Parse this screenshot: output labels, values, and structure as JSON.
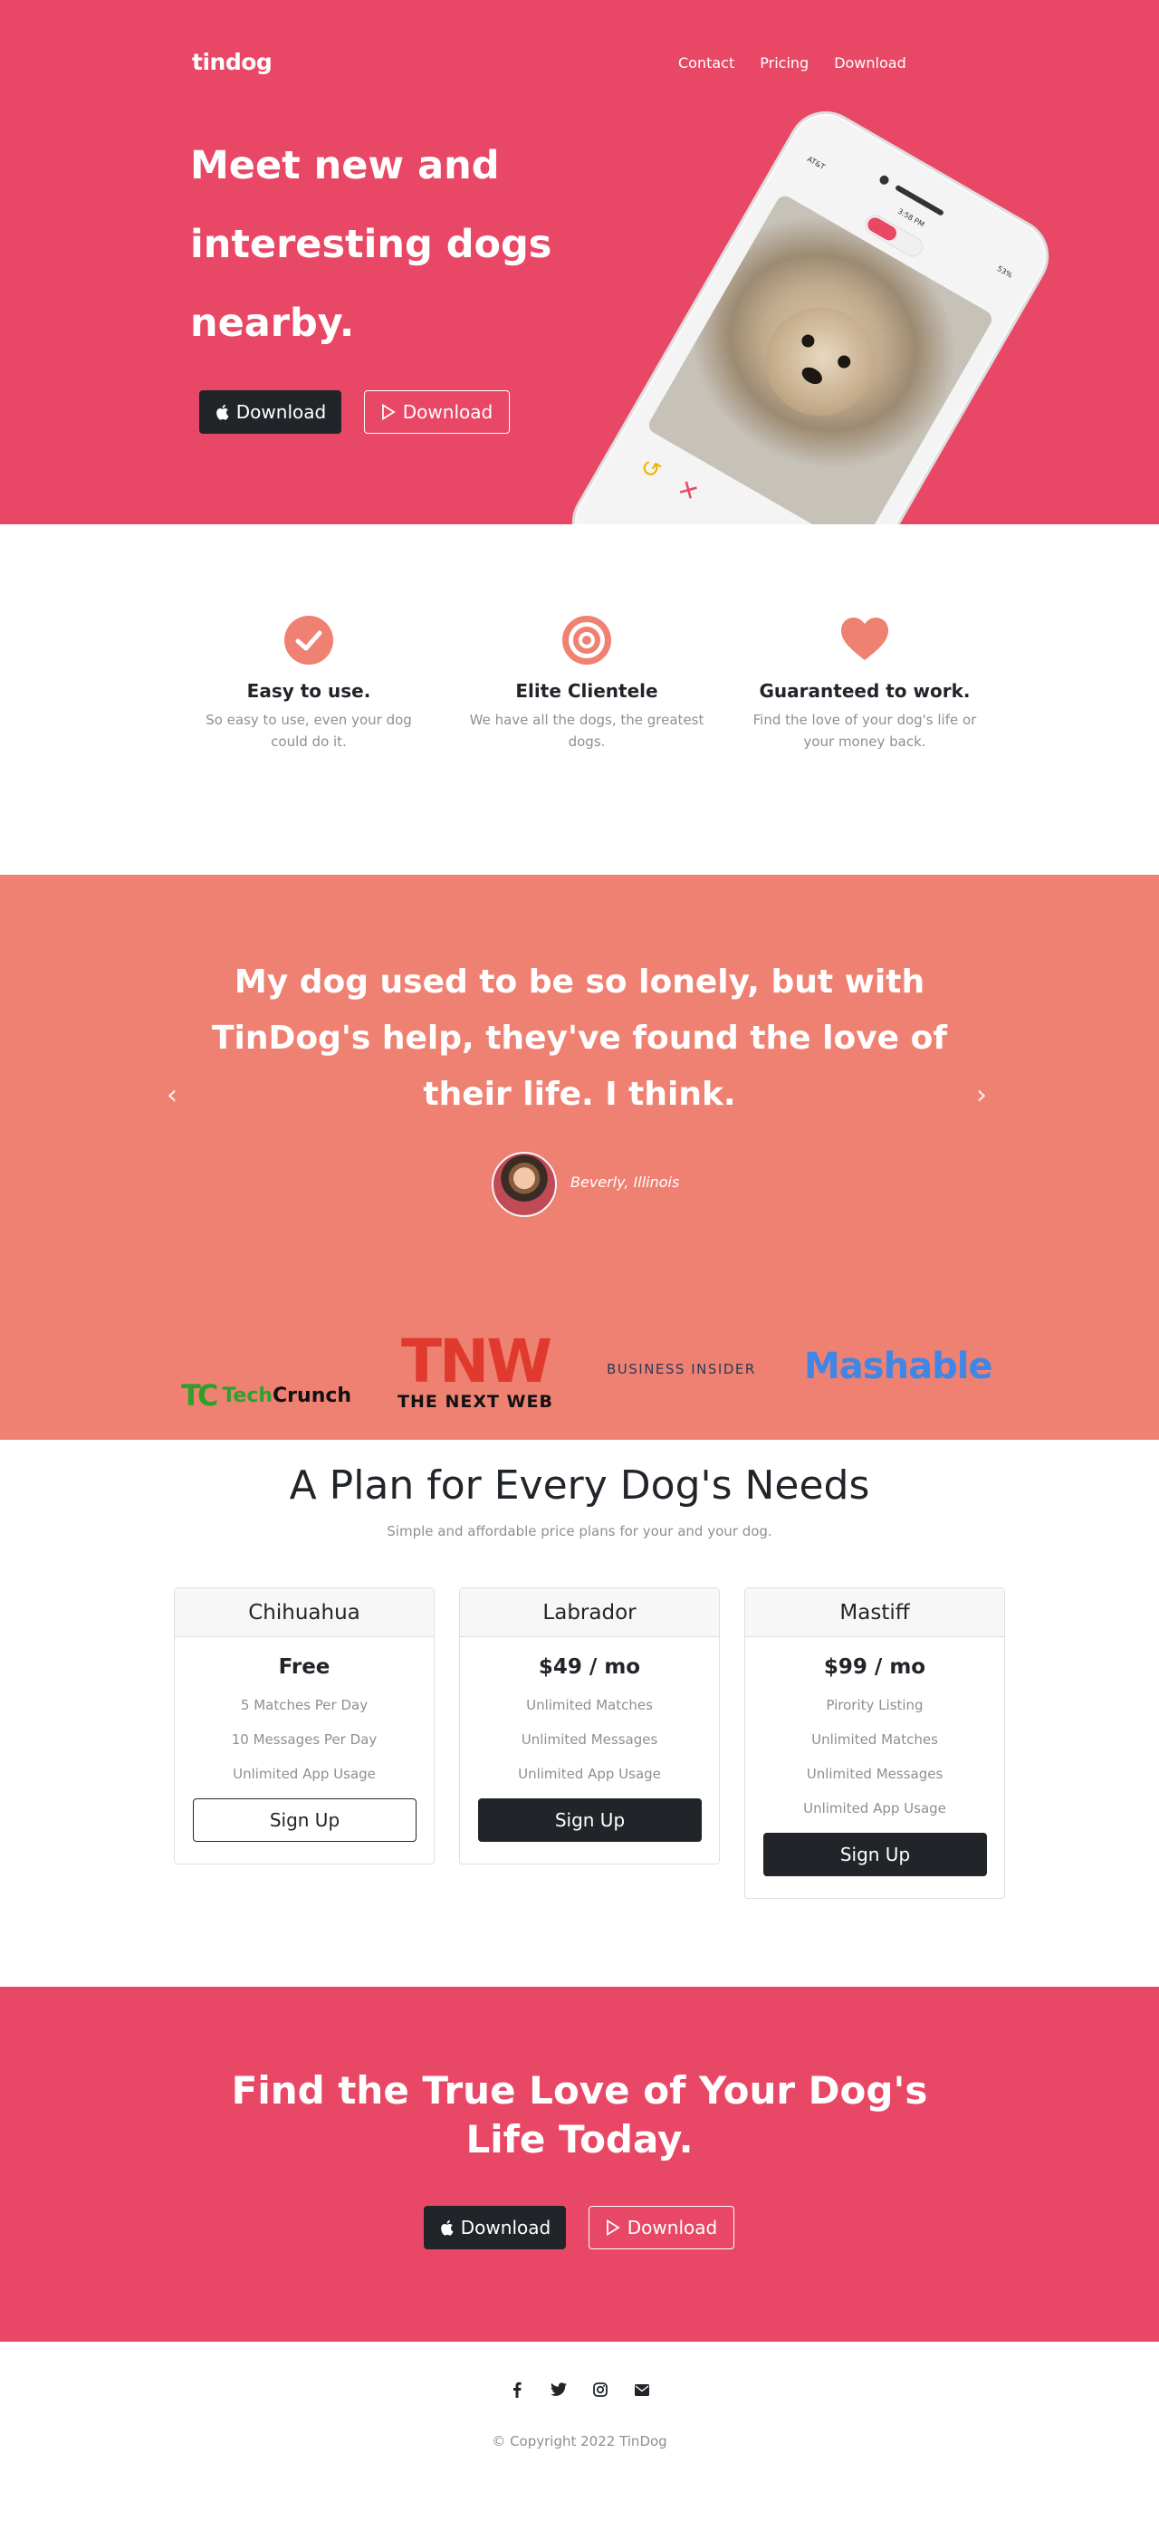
{
  "header": {
    "brand": "tindog",
    "nav": [
      "Contact",
      "Pricing",
      "Download"
    ]
  },
  "hero": {
    "title": "Meet new and interesting dogs nearby.",
    "apple_button": "Download",
    "play_button": "Download",
    "phone": {
      "carrier": "AT&T",
      "time": "3:58 PM",
      "battery": "53%"
    }
  },
  "features": [
    {
      "icon": "check-circle-icon",
      "title": "Easy to use.",
      "text": "So easy to use, even your dog could do it."
    },
    {
      "icon": "bullseye-icon",
      "title": "Elite Clientele",
      "text": "We have all the dogs, the greatest dogs."
    },
    {
      "icon": "heart-icon",
      "title": "Guaranteed to work.",
      "text": "Find the love of your dog's life or your money back."
    }
  ],
  "testimonial": {
    "quote": "My dog used to be so lonely, but with TinDog's help, they've found the love of their life. I think.",
    "author": "Beverly, Illinois"
  },
  "press": {
    "techcrunch_mark": "TC",
    "techcrunch_word_a": "Tech",
    "techcrunch_word_b": "Crunch",
    "tnw_mark": "TNW",
    "tnw_word": "THE NEXT WEB",
    "business_insider": "BUSINESS INSIDER",
    "mashable": "Mashable"
  },
  "pricing": {
    "title": "A Plan for Every Dog's Needs",
    "subtitle": "Simple and affordable price plans for your and your dog.",
    "plans": [
      {
        "name": "Chihuahua",
        "price": "Free",
        "features": [
          "5 Matches Per Day",
          "10 Messages Per Day",
          "Unlimited App Usage"
        ],
        "button": "Sign Up",
        "style": "outline"
      },
      {
        "name": "Labrador",
        "price": "$49 / mo",
        "features": [
          "Unlimited Matches",
          "Unlimited Messages",
          "Unlimited App Usage"
        ],
        "button": "Sign Up",
        "style": "dark"
      },
      {
        "name": "Mastiff",
        "price": "$99 / mo",
        "features": [
          "Pirority Listing",
          "Unlimited Matches",
          "Unlimited Messages",
          "Unlimited App Usage"
        ],
        "button": "Sign Up",
        "style": "dark"
      }
    ]
  },
  "cta": {
    "title_line1": "Find the True Love of Your Dog's",
    "title_line2": "Life Today.",
    "apple_button": "Download",
    "play_button": "Download"
  },
  "footer": {
    "socials": [
      "facebook-icon",
      "twitter-icon",
      "instagram-icon",
      "envelope-icon"
    ],
    "copyright": "© Copyright 2022 TinDog"
  },
  "colors": {
    "primary": "#E84866",
    "coral": "#EF8172",
    "dark": "#212529",
    "muted": "#8F8F8F"
  }
}
